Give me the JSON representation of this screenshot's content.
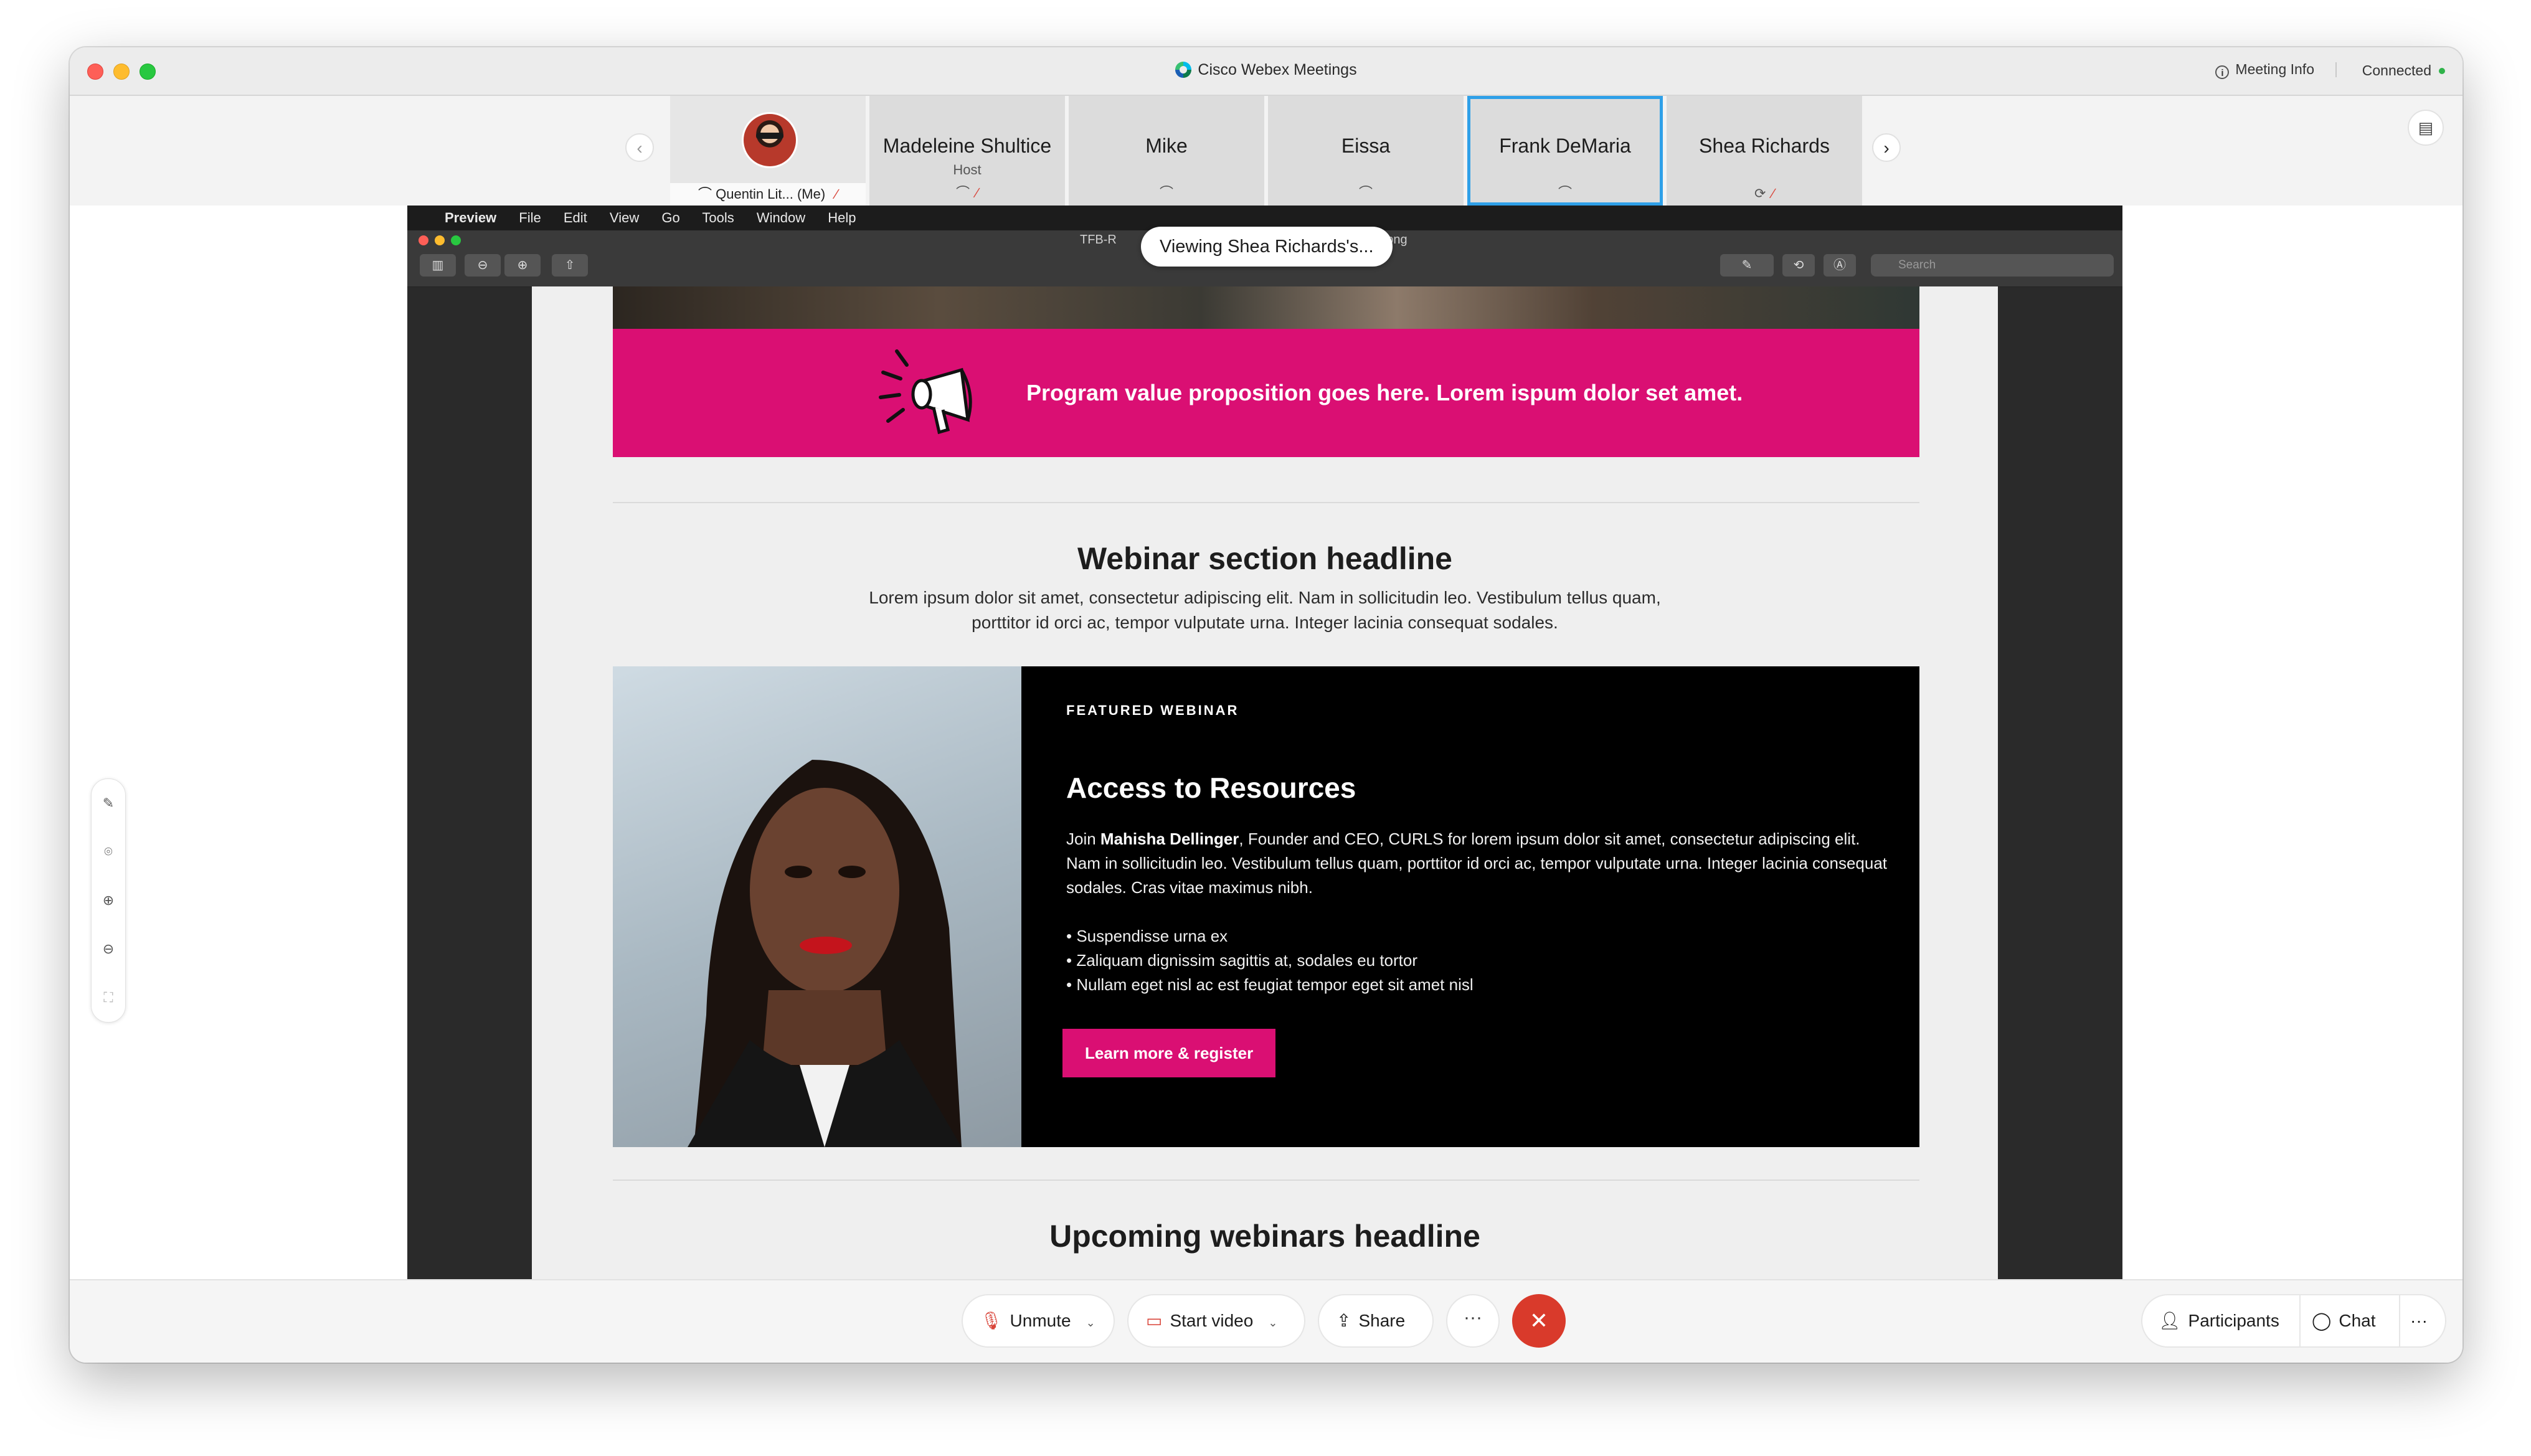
{
  "window": {
    "title": "Cisco Webex Meetings",
    "meeting_info": "Meeting Info",
    "connection_status": "Connected"
  },
  "participants": [
    {
      "name": "Quentin Lit...",
      "suffix": "(Me)",
      "muted": true
    },
    {
      "name": "Madeleine Shultice",
      "role": "Host",
      "muted": true
    },
    {
      "name": "Mike",
      "muted": false
    },
    {
      "name": "Eissa",
      "muted": false
    },
    {
      "name": "Frank DeMaria",
      "muted": false,
      "active_speaker": true
    },
    {
      "name": "Shea Richards",
      "muted": true
    }
  ],
  "share": {
    "viewing_label": "Viewing Shea Richards's...",
    "mac_menu": [
      "Preview",
      "File",
      "Edit",
      "View",
      "Go",
      "Tools",
      "Window",
      "Help"
    ],
    "file_name_left": "TFB-R",
    "file_name_right": "sktop.png",
    "search_placeholder": "Search"
  },
  "document": {
    "banner_text": "Program value proposition goes here. Lorem ispum dolor set amet.",
    "section_headline": "Webinar section headline",
    "section_lede_1": "Lorem ipsum dolor sit amet, consectetur adipiscing elit. Nam in sollicitudin leo. Vestibulum tellus quam,",
    "section_lede_2": "porttitor id orci ac, tempor vulputate urna. Integer lacinia consequat sodales.",
    "featured": {
      "kicker": "FEATURED WEBINAR",
      "title": "Access to Resources",
      "body_prefix": "Join ",
      "body_name": "Mahisha Dellinger",
      "body_rest": ", Founder and CEO, CURLS for lorem ipsum dolor sit amet, consectetur adipiscing elit. Nam in sollicitudin leo. Vestibulum tellus quam, porttitor id orci ac, tempor vulputate urna. Integer lacinia consequat sodales. Cras vitae maximus nibh.",
      "bullets": [
        "• Suspendisse urna ex",
        "• Zaliquam dignissim sagittis at, sodales eu tortor",
        "• Nullam eget nisl ac est feugiat tempor eget sit amet nisl"
      ],
      "cta": "Learn more & register"
    },
    "upcoming_headline": "Upcoming webinars headline"
  },
  "controls": {
    "unmute": "Unmute",
    "start_video": "Start video",
    "share": "Share",
    "more": "···",
    "participants": "Participants",
    "chat": "Chat",
    "overflow": "···"
  },
  "colors": {
    "brand_magenta": "#da0f73",
    "leave_red": "#d93a2b",
    "active_border": "#2fa0e8",
    "connected_green": "#2fb34a"
  }
}
